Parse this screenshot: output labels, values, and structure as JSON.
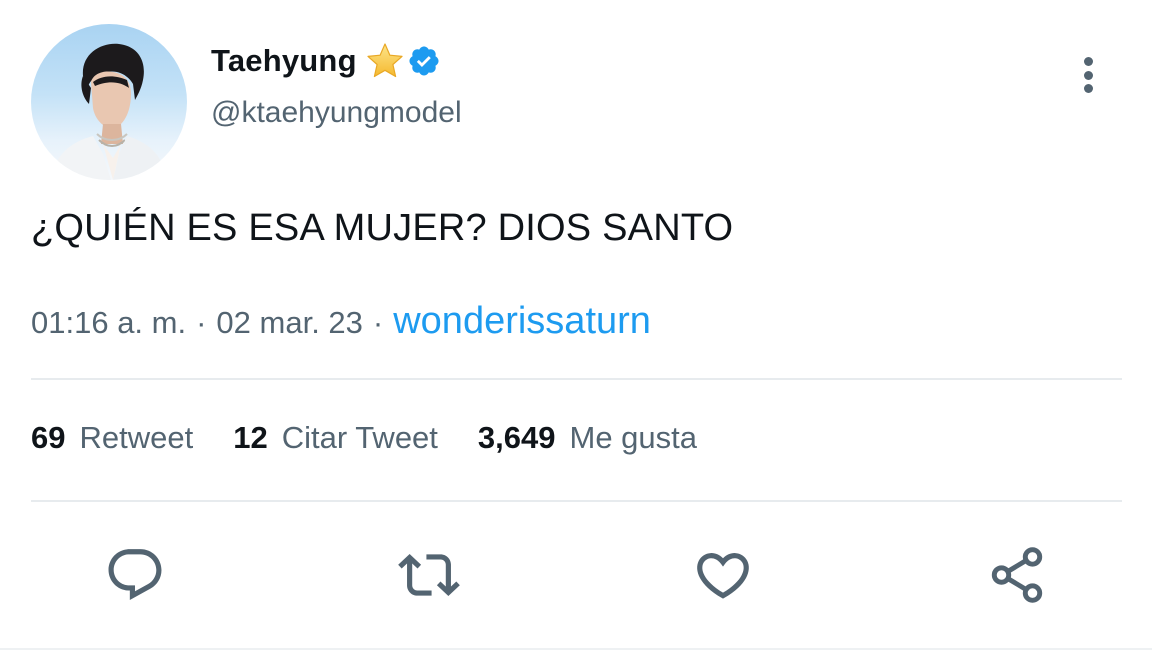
{
  "author": {
    "display_name": "Taehyung",
    "handle": "@ktaehyungmodel",
    "badges": [
      "star-icon",
      "verified-icon"
    ]
  },
  "tweet": {
    "text": "¿QUIÉN ES ESA MUJER? DIOS SANTO",
    "time": "01:16 a. m.",
    "separator": "·",
    "date": "02 mar. 23",
    "source": "wonderissaturn"
  },
  "stats": {
    "retweets_count": "69",
    "retweets_label": "Retweet",
    "quotes_count": "12",
    "quotes_label": "Citar Tweet",
    "likes_count": "3,649",
    "likes_label": "Me gusta"
  },
  "actions": [
    "reply-icon",
    "retweet-icon",
    "like-icon",
    "share-icon"
  ],
  "colors": {
    "link": "#1d9bf0",
    "secondary_text": "#536471",
    "primary_text": "#0f1419",
    "verified": "#1d9bf0",
    "star": "#f7c94b"
  }
}
